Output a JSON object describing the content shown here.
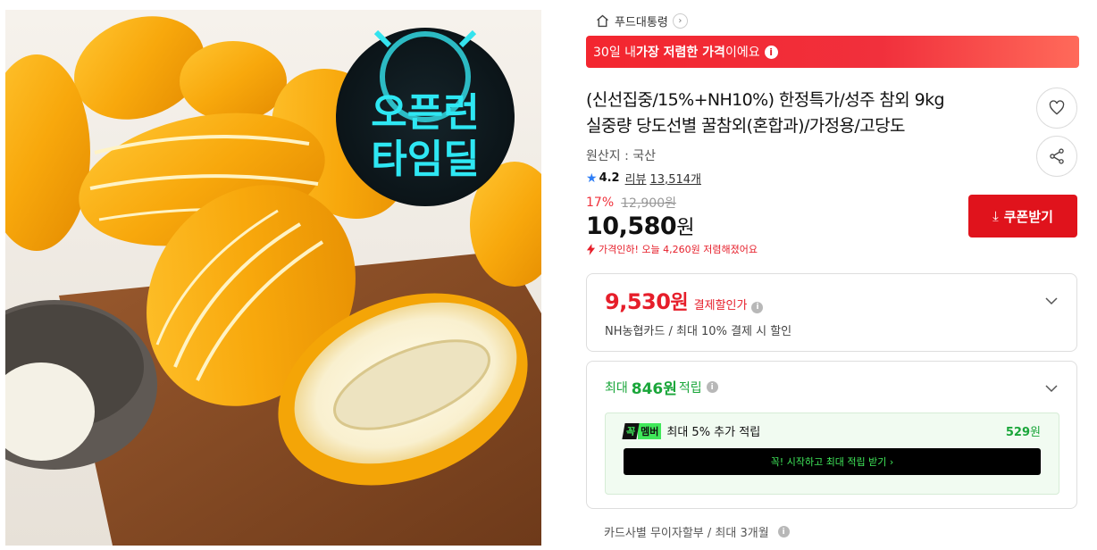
{
  "hero": {
    "badge_line1": "오픈런",
    "badge_line2": "타임딜"
  },
  "breadcrumb": {
    "label": "푸드대통령"
  },
  "banner": {
    "pre": "30일 내 ",
    "bold": "가장 저렴한 가격",
    "post": "이에요"
  },
  "product": {
    "title_line1": "(신선집중/15%+NH10%) 한정특가/성주 참외 9kg",
    "title_line2": "실중량 당도선별 꿀참외(혼합과)/가정용/고당도",
    "origin": "원산지 : 국산",
    "rating": "4.2",
    "review_label": "리뷰",
    "review_count": "13,514개",
    "discount_pct": "17%",
    "original_price": "12,900원",
    "price_amount": "10,580",
    "price_unit": "원",
    "price_drop": "가격인하! 오늘 4,260원 저렴해졌어요"
  },
  "coupon_button": {
    "label": "쿠폰받기"
  },
  "pay_card": {
    "amount": "9,530",
    "unit": "원",
    "label": "결제할인가",
    "sub": "NH농협카드 / 최대 10% 결제 시 할인"
  },
  "points_card": {
    "pre": "최대",
    "amount": "846원",
    "post": "적립",
    "badge_left": "꼭",
    "badge_right": "멤버",
    "member_text": "최대 5% 추가 적립",
    "member_amount": "529",
    "member_unit": "원",
    "start_button": "꼭! 시작하고 최대 적립 받기 ›"
  },
  "installment": {
    "text": "카드사별 무이자할부 / 최대 3개월"
  },
  "colors": {
    "accent_red": "#e0131c",
    "green": "#1aa63a",
    "member_green": "#40e85a"
  }
}
